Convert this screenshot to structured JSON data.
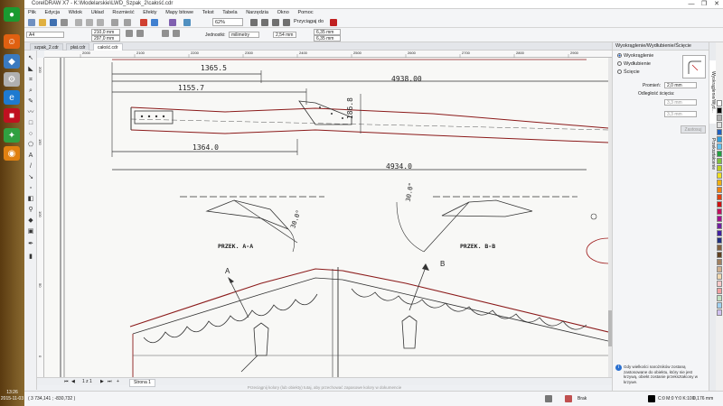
{
  "window": {
    "title": "CorelDRAW X7 - K:\\Modelarskie\\LWD_Szpak_2\\całość.cdr",
    "controls": [
      "—",
      "❐",
      "✕"
    ]
  },
  "menu": [
    "Plik",
    "Edycja",
    "Widok",
    "Układ",
    "Rozmieść",
    "Efekty",
    "Mapy bitowe",
    "Tekst",
    "Tabela",
    "Narzędzia",
    "Okno",
    "Pomoc"
  ],
  "toolbar": {
    "zoom": "62%",
    "snap_label": "Przyciągaj do"
  },
  "propbar": {
    "page_size": "A4",
    "width": "210,0 mm",
    "height": "297,0 mm",
    "units_label": "Jednostki:",
    "units_value": "milimetry",
    "nudge": "2,54 mm",
    "dup_x": "6,35 mm",
    "dup_y": "6,35 mm"
  },
  "doc_tabs": [
    {
      "label": "szpak_2.cdr",
      "active": false
    },
    {
      "label": "płat.cdr",
      "active": false
    },
    {
      "label": "całość.cdr",
      "active": true
    }
  ],
  "ruler_h_ticks": [
    "2000",
    "2100",
    "2200",
    "2300",
    "2400",
    "2500",
    "2600",
    "2700",
    "2800",
    "2900",
    "3000"
  ],
  "ruler_v_ticks": [
    "200",
    "150",
    "100",
    "50",
    "0"
  ],
  "drawing": {
    "dims": [
      "1365.5",
      "4938.00",
      "1155.7",
      "186.8",
      "1364.0",
      "4934.0"
    ],
    "angles": [
      "30.0°",
      "30.0°"
    ],
    "section_labels": [
      "PRZEK. A-A",
      "PRZEK. B-B"
    ],
    "arrows": [
      "A",
      "B"
    ]
  },
  "page_nav": {
    "counter": "1 z 1",
    "page_tab": "Strona 1"
  },
  "hint": "Przeciągnij kolory (lub obiekty) tutaj, aby przechować zapasowe kolory w dokumencie",
  "status": {
    "coords": "( 3 734,141 ; -830,732 )",
    "fill": "Brak",
    "color_info": "C:0 M:0 Y:0 K:100",
    "outline": "0,176 mm"
  },
  "docker": {
    "title": "Wyokrąglenie/Wydłubienie/Ścięcie",
    "options": [
      {
        "label": "Wyokrąglenie",
        "selected": true
      },
      {
        "label": "Wydłubienie",
        "selected": false
      },
      {
        "label": "Ścięcie",
        "selected": false
      }
    ],
    "radius_label": "Promień:",
    "radius_value": "2,0 mm",
    "distance_label": "Odległość ścięcia:",
    "dist_a": "3,3 mm",
    "dist_b": "3,3 mm",
    "apply": "Zastosuj",
    "info": "Gdy wielkości narożników zostaną zastosowane do obiektu, który nie jest krzywą, obiekt zostanie przekształcony w krzywe."
  },
  "docker_tabs": [
    "Wyokrąglenie/Wyd...",
    "Przekształcenie"
  ],
  "taskbar": {
    "time": "13:26",
    "date": "2015-11-03"
  },
  "palette_colors": [
    "#ffffff",
    "#000000",
    "#b0b0b0",
    "#e0e0e0",
    "#2060c0",
    "#30a0e0",
    "#60c0f0",
    "#20a040",
    "#80c040",
    "#c0d020",
    "#f0e020",
    "#f0b010",
    "#f08010",
    "#e04010",
    "#d01010",
    "#c01060",
    "#a01090",
    "#7020a0",
    "#4020a0",
    "#203080",
    "#806040",
    "#604020",
    "#a08060",
    "#d0b090",
    "#f0d8b0",
    "#f8c8c8",
    "#f0a0a0",
    "#c0e0c0",
    "#a0d0f0",
    "#d0c0f0"
  ]
}
